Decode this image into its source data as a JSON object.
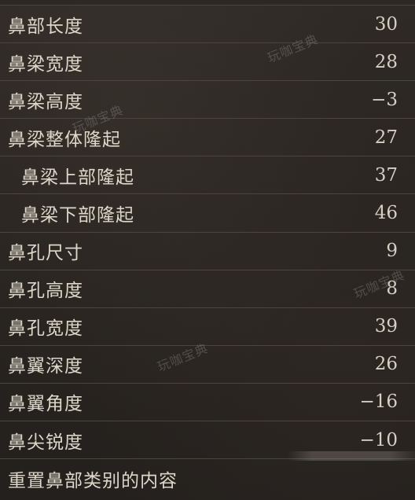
{
  "settings": {
    "rows": [
      {
        "label": "鼻部长度",
        "value": "30"
      },
      {
        "label": "鼻梁宽度",
        "value": "28"
      },
      {
        "label": "鼻梁高度",
        "value": "−3"
      },
      {
        "label": "鼻梁整体隆起",
        "value": "27"
      },
      {
        "label": "鼻梁上部隆起",
        "value": "37"
      },
      {
        "label": "鼻梁下部隆起",
        "value": "46"
      },
      {
        "label": "鼻孔尺寸",
        "value": "9"
      },
      {
        "label": "鼻孔高度",
        "value": "8"
      },
      {
        "label": "鼻孔宽度",
        "value": "39"
      },
      {
        "label": "鼻翼深度",
        "value": "26"
      },
      {
        "label": "鼻翼角度",
        "value": "−16"
      },
      {
        "label": "鼻尖锐度",
        "value": "−10"
      }
    ],
    "reset_label": "重置鼻部类别的内容"
  },
  "watermark": {
    "text": "玩咖宝典"
  },
  "colors": {
    "background": "#2a2622",
    "divider": "#4b453e",
    "text": "#ddd7ca"
  }
}
